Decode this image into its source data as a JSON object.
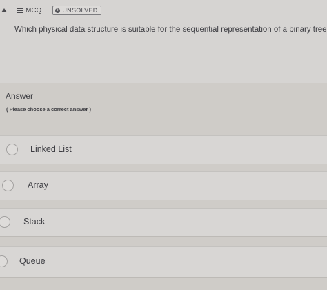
{
  "header": {
    "type_label": "MCQ",
    "status_label": "UNSOLVED"
  },
  "question": {
    "text": "Which physical data structure is suitable for the sequential representation of a binary tree?"
  },
  "answer": {
    "heading": "Answer",
    "hint": "( Please choose a correct answer )",
    "options": [
      {
        "label": "Linked List"
      },
      {
        "label": "Array"
      },
      {
        "label": "Stack"
      },
      {
        "label": "Queue"
      }
    ]
  }
}
